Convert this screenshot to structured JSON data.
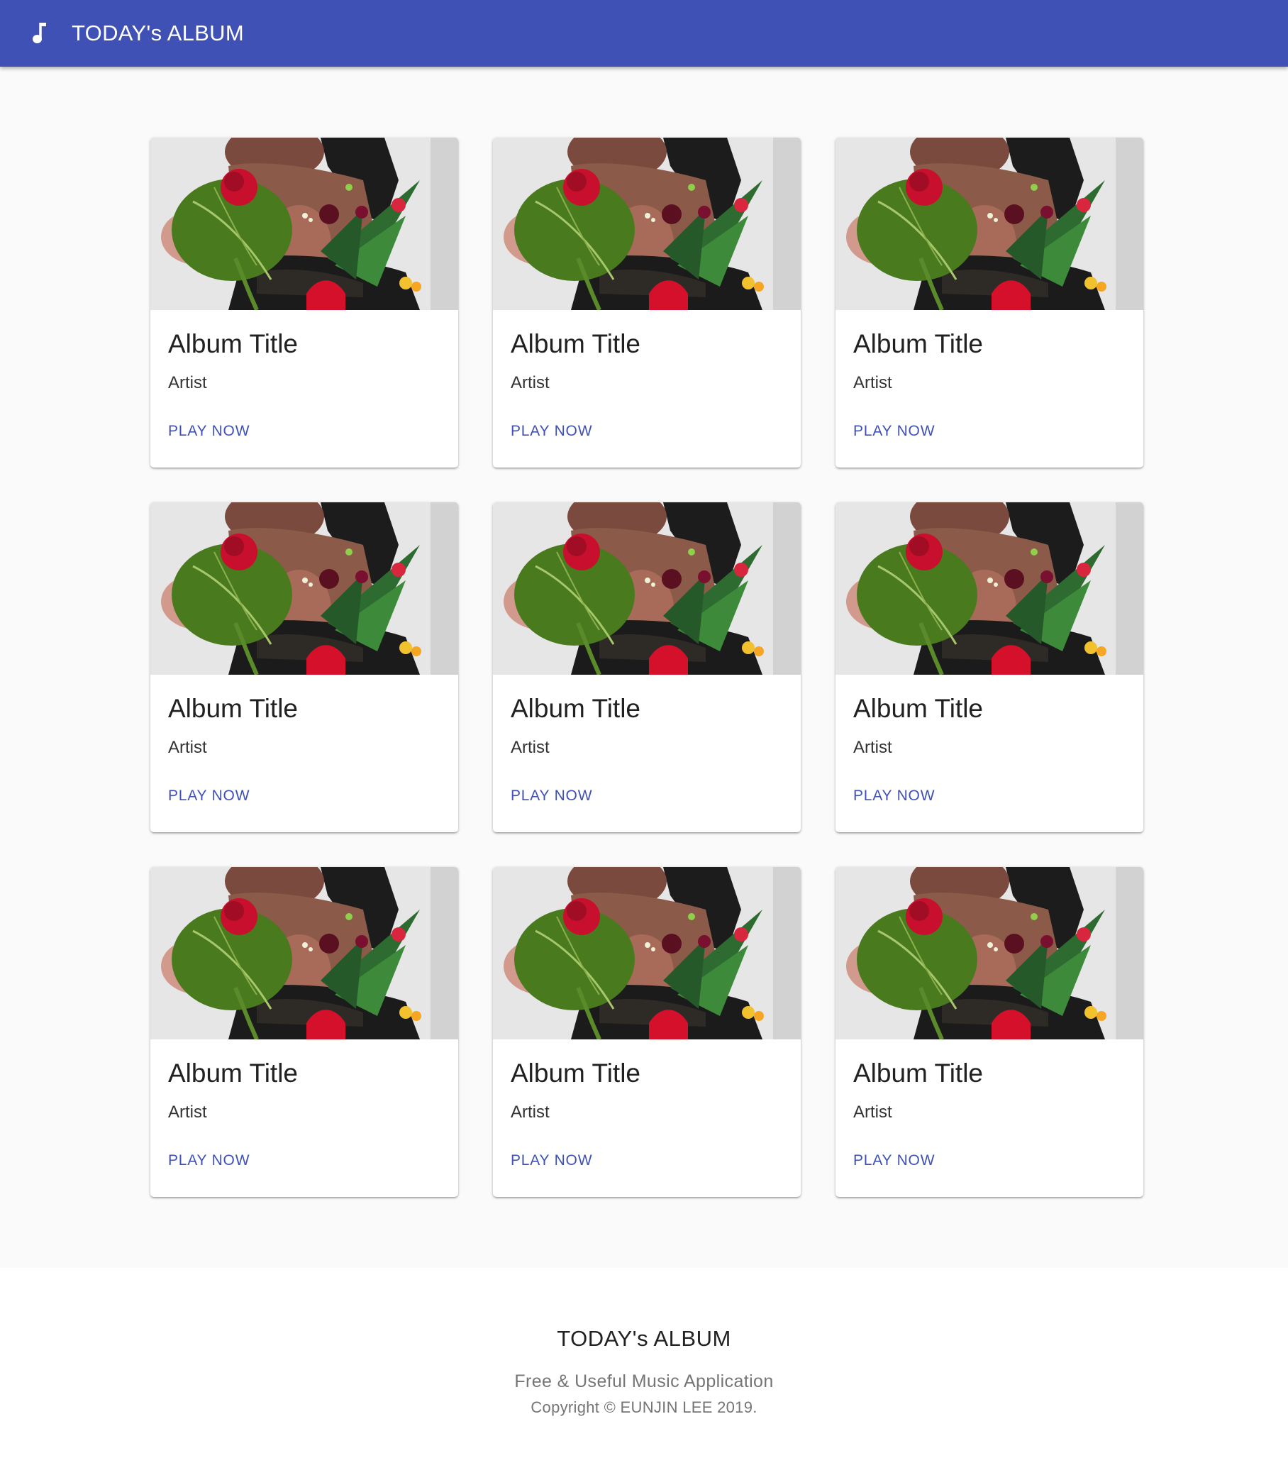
{
  "header": {
    "app_title": "TODAY's ALBUM",
    "icon": "music-note-icon",
    "background": "#3f51b5"
  },
  "albums": [
    {
      "title": "Album Title",
      "artist": "Artist",
      "action": "PLAY NOW"
    },
    {
      "title": "Album Title",
      "artist": "Artist",
      "action": "PLAY NOW"
    },
    {
      "title": "Album Title",
      "artist": "Artist",
      "action": "PLAY NOW"
    },
    {
      "title": "Album Title",
      "artist": "Artist",
      "action": "PLAY NOW"
    },
    {
      "title": "Album Title",
      "artist": "Artist",
      "action": "PLAY NOW"
    },
    {
      "title": "Album Title",
      "artist": "Artist",
      "action": "PLAY NOW"
    },
    {
      "title": "Album Title",
      "artist": "Artist",
      "action": "PLAY NOW"
    },
    {
      "title": "Album Title",
      "artist": "Artist",
      "action": "PLAY NOW"
    },
    {
      "title": "Album Title",
      "artist": "Artist",
      "action": "PLAY NOW"
    }
  ],
  "footer": {
    "title": "TODAY's ALBUM",
    "subtitle": "Free & Useful Music Application",
    "copyright": "Copyright © EUNJIN LEE 2019."
  },
  "colors": {
    "primary": "#3f51b5",
    "page_background": "#fafafa"
  }
}
